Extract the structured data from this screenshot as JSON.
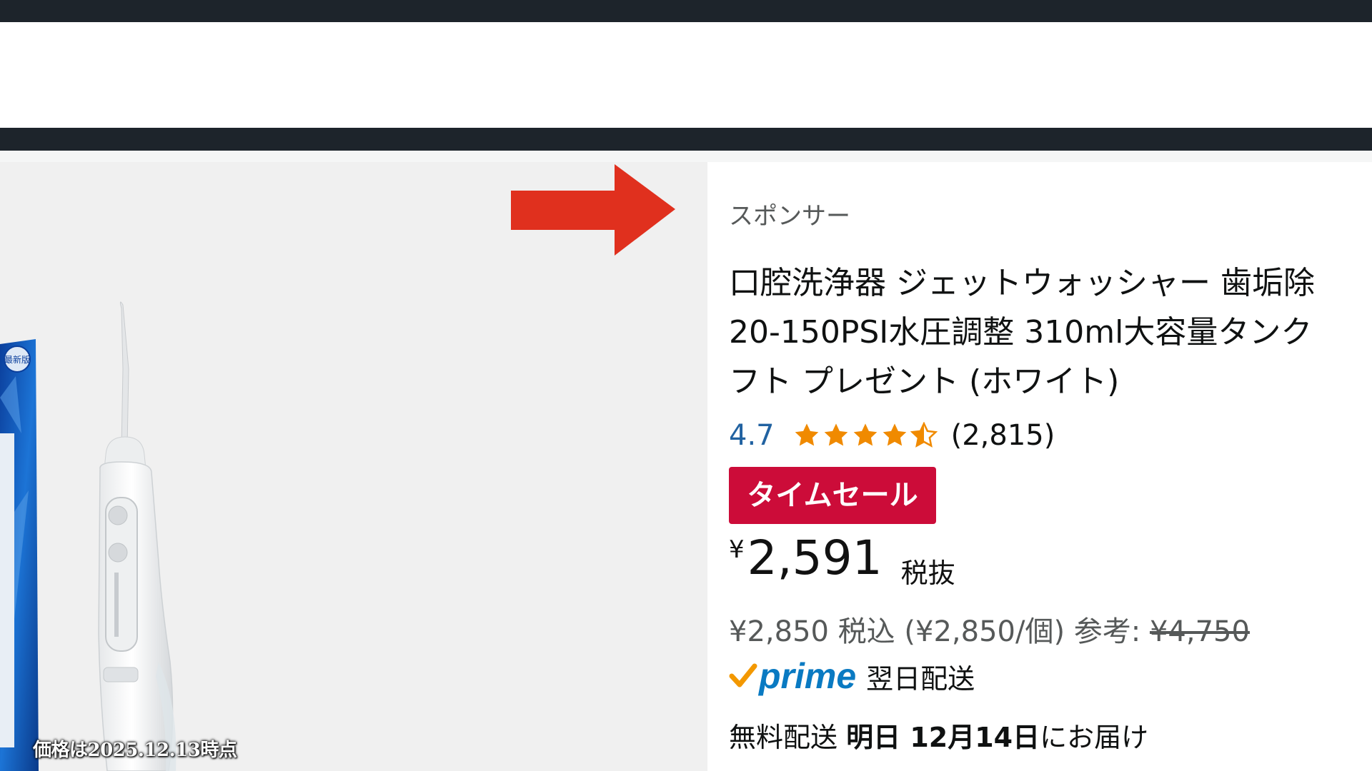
{
  "listing": {
    "sponsored_label": "スポンサー",
    "title_lines": [
      "口腔洗浄器 ジェットウォッシャー 歯垢除",
      "20-150PSI水圧調整 310ml大容量タンク",
      "フト プレゼント (ホワイト)"
    ],
    "rating": "4.7",
    "rating_value": 4.7,
    "review_count": "(2,815)",
    "sale_badge": "タイムセール",
    "price_currency": "¥",
    "price": "2,591",
    "price_tax_label": "税抜",
    "price_incl_tax": "¥2,850",
    "price_incl_label": "税込",
    "unit_price": "(¥2,850/個)",
    "reference_label": "参考:",
    "reference_price": "¥4,750",
    "prime_logo": "prime",
    "prime_delivery": "翌日配送",
    "delivery_prefix": "無料配送",
    "delivery_date": "明日 12月14日",
    "delivery_suffix": "にお届け"
  },
  "image_panel": {
    "box_label": "最新版",
    "price_note": "価格は2025.12.13時点"
  },
  "icons": {
    "arrow": "right-arrow-icon",
    "star": "star-icon",
    "prime_check": "check-icon"
  },
  "colors": {
    "arrow": "#e0301e",
    "star": "#f08a00",
    "badge": "#cc0c39",
    "rating_link": "#2162a1",
    "prime_blue": "#0a7ac2",
    "prime_check": "#f39800"
  }
}
